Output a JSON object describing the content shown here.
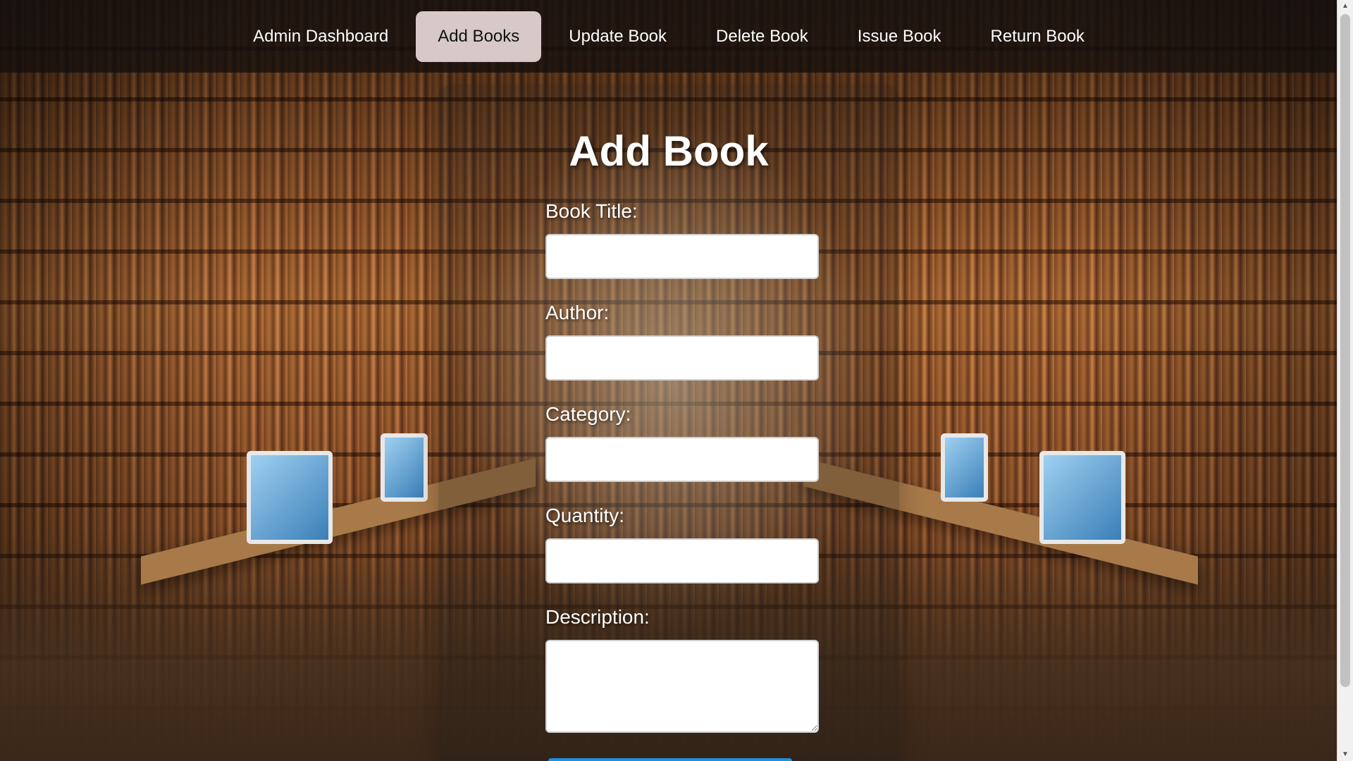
{
  "nav": {
    "items": [
      {
        "label": "Admin Dashboard"
      },
      {
        "label": "Add Books"
      },
      {
        "label": "Update Book"
      },
      {
        "label": "Delete Book"
      },
      {
        "label": "Issue Book"
      },
      {
        "label": "Return Book"
      }
    ],
    "active": "Add Books"
  },
  "form": {
    "title": "Add Book",
    "fields": {
      "book_title": {
        "label": "Book Title:",
        "value": ""
      },
      "author": {
        "label": "Author:",
        "value": ""
      },
      "category": {
        "label": "Category:",
        "value": ""
      },
      "quantity": {
        "label": "Quantity:",
        "value": ""
      },
      "description": {
        "label": "Description:",
        "value": ""
      }
    }
  },
  "colors": {
    "nav_active_bg": "#d8c9c9",
    "submit_button": "#1f8fe0"
  }
}
